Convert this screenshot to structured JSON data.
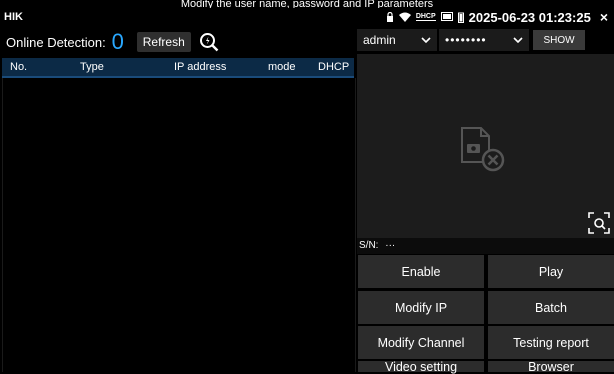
{
  "status_bar": {
    "app_title": "HIK",
    "dhcp_label": "DHCP",
    "datetime": "2025-06-23 01:23:25",
    "close_symbol": "×"
  },
  "top_hint": "Modify the user name, password and IP parameters",
  "detection": {
    "label": "Online Detection:",
    "count": "0",
    "refresh_label": "Refresh"
  },
  "table": {
    "columns": [
      "No.",
      "Type",
      "IP address",
      "mode",
      "DHCP"
    ],
    "rows": []
  },
  "credentials": {
    "username": "admin",
    "password_mask": "••••••••",
    "show_label": "SHOW"
  },
  "serial": {
    "label": "S/N:",
    "value": "···"
  },
  "actions": [
    "Enable",
    "Play",
    "Modify IP",
    "Batch",
    "Modify Channel",
    "Testing report",
    "Video setting",
    "Browser"
  ],
  "colors": {
    "accent_count": "#29a8ff",
    "table_header_bg": "#0c2a46",
    "button_bg": "#2c2c2c",
    "preview_bg": "#1c1c1c"
  }
}
